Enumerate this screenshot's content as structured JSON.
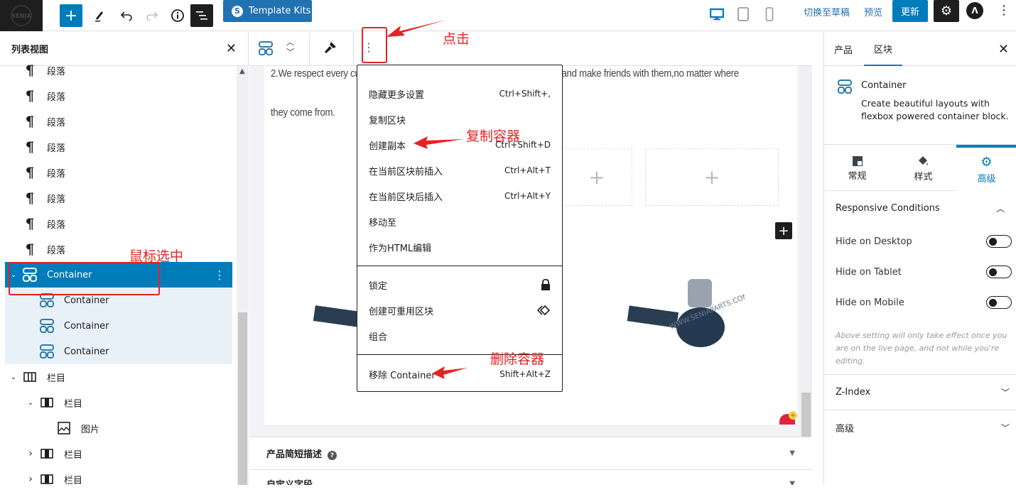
{
  "topbar": {
    "logo_text": "SENIA",
    "add_label": "+",
    "template_kits_label": "Template Kits",
    "switch_draft": "切换至草稿",
    "preview": "预览",
    "update": "更新",
    "devices": [
      "desktop",
      "tablet",
      "mobile"
    ],
    "active_device": "desktop"
  },
  "list_view": {
    "title": "列表视图",
    "items": [
      {
        "label": "段落",
        "icon": "paragraph-icon",
        "level": 0
      },
      {
        "label": "段落",
        "icon": "paragraph-icon",
        "level": 0
      },
      {
        "label": "段落",
        "icon": "paragraph-icon",
        "level": 0
      },
      {
        "label": "段落",
        "icon": "paragraph-icon",
        "level": 0
      },
      {
        "label": "段落",
        "icon": "paragraph-icon",
        "level": 0
      },
      {
        "label": "段落",
        "icon": "paragraph-icon",
        "level": 0
      },
      {
        "label": "段落",
        "icon": "paragraph-icon",
        "level": 0
      },
      {
        "label": "段落",
        "icon": "paragraph-icon",
        "level": 0
      },
      {
        "label": "Container",
        "icon": "container-icon",
        "level": 0,
        "selected": true,
        "expanded": true
      },
      {
        "label": "Container",
        "icon": "container-icon",
        "level": 1
      },
      {
        "label": "Container",
        "icon": "container-icon",
        "level": 1
      },
      {
        "label": "Container",
        "icon": "container-icon",
        "level": 1
      },
      {
        "label": "栏目",
        "icon": "columns-icon",
        "level": 0,
        "expanded": true
      },
      {
        "label": "栏目",
        "icon": "column-icon",
        "level": 1,
        "expanded": true
      },
      {
        "label": "图片",
        "icon": "image-icon",
        "level": 2
      },
      {
        "label": "栏目",
        "icon": "column-icon",
        "level": 1,
        "expanded": false
      },
      {
        "label": "栏目",
        "icon": "column-icon",
        "level": 1,
        "expanded": false
      }
    ]
  },
  "canvas": {
    "text_line1": "2.We respect every customer as our friend and we sincerely do business and make friends with them,no matter where",
    "text_line2": "they come from.",
    "placeholder_plus": "+",
    "watermark": "WWW.SENIAPARTS.COM",
    "meta_boxes": [
      {
        "label": "产品简短描述",
        "has_help": true
      },
      {
        "label": "自定义字段",
        "has_help": false
      }
    ]
  },
  "block_menu": {
    "group1": [
      {
        "label": "隐藏更多设置",
        "shortcut": "Ctrl+Shift+,"
      },
      {
        "label": "复制区块",
        "shortcut": ""
      },
      {
        "label": "创建副本",
        "shortcut": "Ctrl+Shift+D"
      },
      {
        "label": "在当前区块前插入",
        "shortcut": "Ctrl+Alt+T"
      },
      {
        "label": "在当前区块后插入",
        "shortcut": "Ctrl+Alt+Y"
      },
      {
        "label": "移动至",
        "shortcut": ""
      },
      {
        "label": "作为HTML编辑",
        "shortcut": ""
      }
    ],
    "group2": [
      {
        "label": "锁定",
        "icon": "lock-icon"
      },
      {
        "label": "创建可重用区块",
        "icon": "reusable-icon"
      },
      {
        "label": "组合",
        "icon": ""
      }
    ],
    "group3": [
      {
        "label": "移除 Container",
        "shortcut": "Shift+Alt+Z"
      }
    ]
  },
  "sidebar": {
    "tabs": [
      {
        "label": "产品",
        "active": false
      },
      {
        "label": "区块",
        "active": true
      }
    ],
    "block": {
      "name": "Container",
      "description": "Create beautiful layouts with flexbox powered container block."
    },
    "inspector_tabs": [
      {
        "label": "常规",
        "active": false
      },
      {
        "label": "样式",
        "active": false
      },
      {
        "label": "高级",
        "active": true
      }
    ],
    "responsive": {
      "title": "Responsive Conditions",
      "toggles": [
        {
          "label": "Hide on Desktop",
          "on": false
        },
        {
          "label": "Hide on Tablet",
          "on": false
        },
        {
          "label": "Hide on Mobile",
          "on": false
        }
      ],
      "note": "Above setting will only take effect once you are on the live page, and not while you're editing."
    },
    "panels": [
      {
        "label": "Z-Index"
      },
      {
        "label": "高级"
      }
    ]
  },
  "annotations": {
    "click": "点击",
    "select": "鼠标选中",
    "duplicate": "复制容器",
    "delete": "删除容器"
  },
  "colors": {
    "accent": "#007cba",
    "annotation_red": "#e52222",
    "template_kits": "#2271b1"
  }
}
